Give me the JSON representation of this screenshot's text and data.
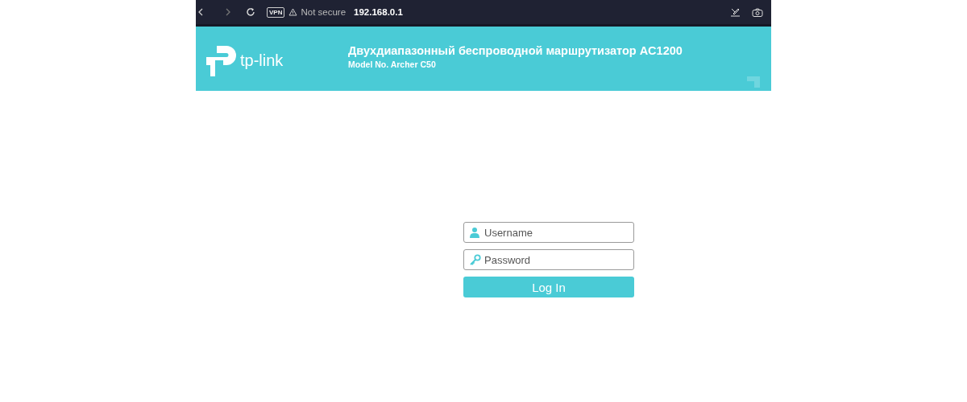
{
  "browser": {
    "vpn_badge": "VPN",
    "security": "Not secure",
    "address": "192.168.0.1"
  },
  "header": {
    "logo_text": "tp-link",
    "title": "Двухдиапазонный беспроводной маршрутизатор AC1200",
    "model": "Model No. Archer C50"
  },
  "login": {
    "username": {
      "placeholder": "Username"
    },
    "password": {
      "placeholder": "Password"
    },
    "button": "Log In"
  }
}
